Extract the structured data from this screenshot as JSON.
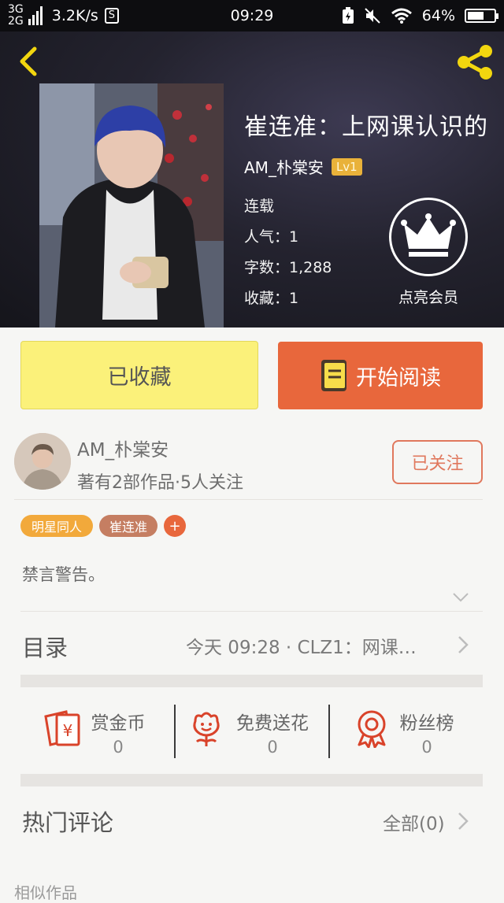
{
  "status_bar": {
    "network_top": "3G",
    "network_bottom": "2G",
    "speed": "3.2K/s",
    "s_icon_label": "S",
    "time": "09:29",
    "battery": "64%",
    "battery_level": 0.64
  },
  "header": {
    "title": "崔连准：上网课认识的",
    "author": "AM_朴棠安",
    "level": "Lv1",
    "status": "连载",
    "popularity": "人气：1",
    "word_count": "字数：1,288",
    "favorites": "收藏：1",
    "vip_label": "点亮会员"
  },
  "actions": {
    "favorite_label": "已收藏",
    "read_label": "开始阅读"
  },
  "author_card": {
    "name": "AM_朴棠安",
    "stats": "著有2部作品·5人关注",
    "follow_label": "已关注"
  },
  "tags": [
    {
      "label": "明星同人",
      "color": "#f2a93b"
    },
    {
      "label": "崔连准",
      "color": "#c57e62"
    },
    {
      "label": "+",
      "color": "#e8673c"
    }
  ],
  "description": "禁言警告。",
  "catalog": {
    "title": "目录",
    "latest": "今天 09:28 · CLZ1：网课…"
  },
  "rewards": [
    {
      "label": "赏金币",
      "count": "0",
      "icon": "red-envelope-icon"
    },
    {
      "label": "免费送花",
      "count": "0",
      "icon": "flower-icon"
    },
    {
      "label": "粉丝榜",
      "count": "0",
      "icon": "medal-icon"
    }
  ],
  "comments": {
    "title": "热门评论",
    "all_label": "全部(0)"
  },
  "similar": {
    "title": "相似作品"
  },
  "colors": {
    "accent_orange": "#e8673c",
    "favorite_yellow": "#fbf17a",
    "level_badge": "#e9b23a",
    "icon_red": "#d9432a"
  }
}
